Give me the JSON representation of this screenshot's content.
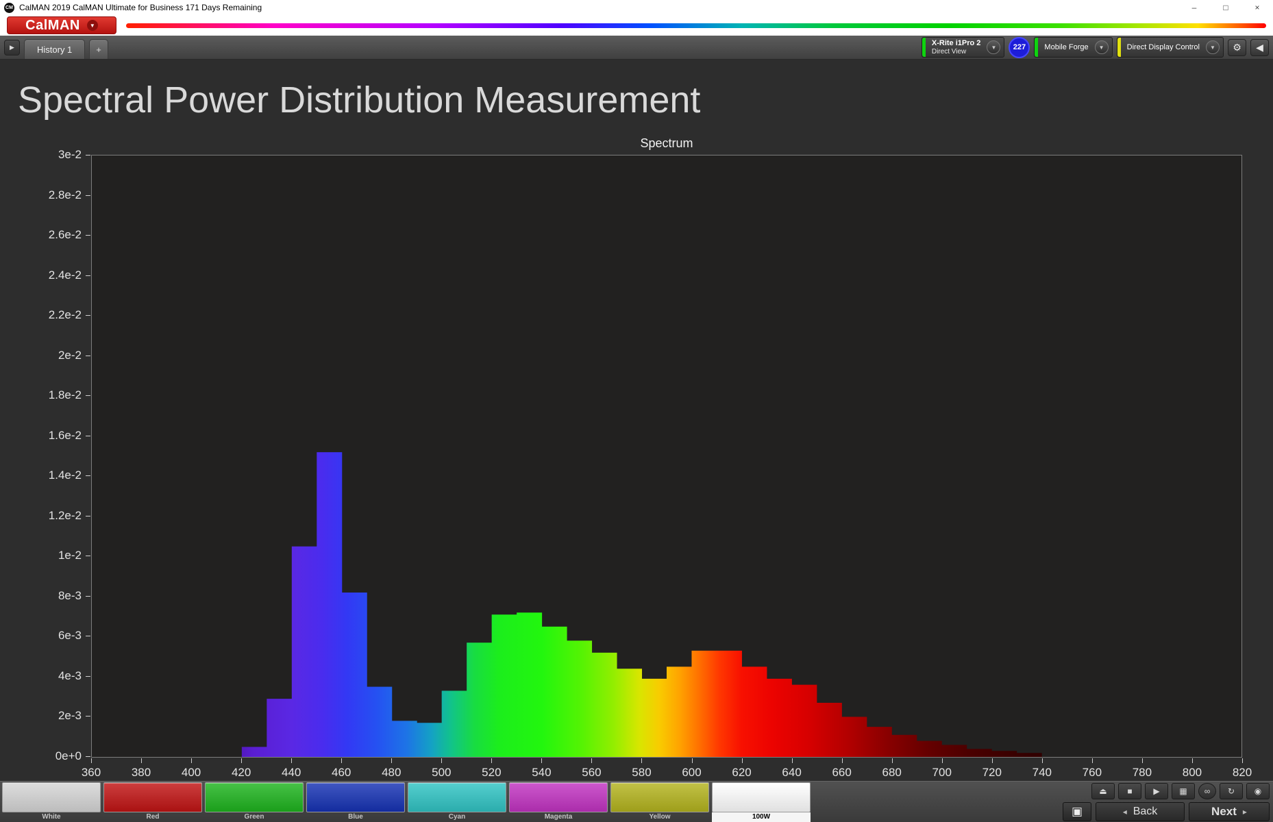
{
  "window": {
    "app_icon": "CM",
    "title": "CalMAN 2019 CalMAN Ultimate for Business 171 Days Remaining",
    "minimize_glyph": "–",
    "maximize_glyph": "□",
    "close_glyph": "×"
  },
  "brand": {
    "logo_text": "CalMAN",
    "logo_color": "#c3161c",
    "dropdown_glyph": "▼"
  },
  "tabbar": {
    "expand_glyph": "▶",
    "tabs": [
      {
        "label": "History 1"
      }
    ],
    "add_tab_label": "+",
    "meter_dropdown": {
      "line1": "X-Rite i1Pro 2",
      "line2": "Direct View",
      "accent_color": "#0fd40f",
      "arrow_glyph": "▼"
    },
    "reading_badge": {
      "value": "227",
      "color": "#1d1dd8"
    },
    "source_dropdown": {
      "label": "Mobile Forge",
      "accent_color": "#0fd40f",
      "arrow_glyph": "▼"
    },
    "display_dropdown": {
      "label": "Direct Display Control",
      "accent_color": "#e0e010",
      "arrow_glyph": "▼"
    },
    "settings_glyph": "⚙",
    "collapse_glyph": "◀"
  },
  "page": {
    "title": "Spectral Power Distribution Measurement"
  },
  "chart_data": {
    "type": "bar",
    "title": "Spectrum",
    "xlabel": "",
    "ylabel": "",
    "grid": false,
    "legend": false,
    "xlim": [
      360,
      820
    ],
    "ylim": [
      0,
      0.03
    ],
    "x_ticks": [
      360,
      380,
      400,
      420,
      440,
      460,
      480,
      500,
      520,
      540,
      560,
      580,
      600,
      620,
      640,
      660,
      680,
      700,
      720,
      740,
      760,
      780,
      800,
      820
    ],
    "y_ticks": [
      {
        "value": 0.03,
        "label": "3e-2"
      },
      {
        "value": 0.028,
        "label": "2.8e-2"
      },
      {
        "value": 0.026,
        "label": "2.6e-2"
      },
      {
        "value": 0.024,
        "label": "2.4e-2"
      },
      {
        "value": 0.022,
        "label": "2.2e-2"
      },
      {
        "value": 0.02,
        "label": "2e-2"
      },
      {
        "value": 0.018,
        "label": "1.8e-2"
      },
      {
        "value": 0.016,
        "label": "1.6e-2"
      },
      {
        "value": 0.014,
        "label": "1.4e-2"
      },
      {
        "value": 0.012,
        "label": "1.2e-2"
      },
      {
        "value": 0.01,
        "label": "1e-2"
      },
      {
        "value": 0.008,
        "label": "8e-3"
      },
      {
        "value": 0.006,
        "label": "6e-3"
      },
      {
        "value": 0.004,
        "label": "4e-3"
      },
      {
        "value": 0.002,
        "label": "2e-3"
      },
      {
        "value": 0.0,
        "label": "0e+0"
      }
    ],
    "bin_width_nm": 10,
    "bins": [
      {
        "nm": 420,
        "value": 0.0005
      },
      {
        "nm": 430,
        "value": 0.0029
      },
      {
        "nm": 440,
        "value": 0.0105
      },
      {
        "nm": 450,
        "value": 0.0152
      },
      {
        "nm": 460,
        "value": 0.0082
      },
      {
        "nm": 470,
        "value": 0.0035
      },
      {
        "nm": 480,
        "value": 0.0018
      },
      {
        "nm": 490,
        "value": 0.0017
      },
      {
        "nm": 500,
        "value": 0.0033
      },
      {
        "nm": 510,
        "value": 0.0057
      },
      {
        "nm": 520,
        "value": 0.0071
      },
      {
        "nm": 530,
        "value": 0.0072
      },
      {
        "nm": 540,
        "value": 0.0065
      },
      {
        "nm": 550,
        "value": 0.0058
      },
      {
        "nm": 560,
        "value": 0.0052
      },
      {
        "nm": 570,
        "value": 0.0044
      },
      {
        "nm": 580,
        "value": 0.0039
      },
      {
        "nm": 590,
        "value": 0.0045
      },
      {
        "nm": 600,
        "value": 0.0053
      },
      {
        "nm": 610,
        "value": 0.0053
      },
      {
        "nm": 620,
        "value": 0.0045
      },
      {
        "nm": 630,
        "value": 0.0039
      },
      {
        "nm": 640,
        "value": 0.0036
      },
      {
        "nm": 650,
        "value": 0.0027
      },
      {
        "nm": 660,
        "value": 0.002
      },
      {
        "nm": 670,
        "value": 0.0015
      },
      {
        "nm": 680,
        "value": 0.0011
      },
      {
        "nm": 690,
        "value": 0.0008
      },
      {
        "nm": 700,
        "value": 0.0006
      },
      {
        "nm": 710,
        "value": 0.0004
      },
      {
        "nm": 720,
        "value": 0.0003
      },
      {
        "nm": 730,
        "value": 0.0002
      }
    ],
    "spectrum_gradient": [
      {
        "nm": 360,
        "hex": "#240550"
      },
      {
        "nm": 405,
        "hex": "#3c0a8c"
      },
      {
        "nm": 425,
        "hex": "#5a1ed2"
      },
      {
        "nm": 440,
        "hex": "#5a28e4"
      },
      {
        "nm": 452,
        "hex": "#4a2cee"
      },
      {
        "nm": 462,
        "hex": "#3338f4"
      },
      {
        "nm": 474,
        "hex": "#2551f2"
      },
      {
        "nm": 486,
        "hex": "#1d74e6"
      },
      {
        "nm": 496,
        "hex": "#14a2c4"
      },
      {
        "nm": 504,
        "hex": "#12c488"
      },
      {
        "nm": 513,
        "hex": "#18dc42"
      },
      {
        "nm": 523,
        "hex": "#1cee1c"
      },
      {
        "nm": 540,
        "hex": "#22f60e"
      },
      {
        "nm": 556,
        "hex": "#55f303"
      },
      {
        "nm": 569,
        "hex": "#94ee00"
      },
      {
        "nm": 579,
        "hex": "#d8e600"
      },
      {
        "nm": 587,
        "hex": "#f8cc00"
      },
      {
        "nm": 595,
        "hex": "#ffa400"
      },
      {
        "nm": 603,
        "hex": "#ff7000"
      },
      {
        "nm": 611,
        "hex": "#ff3800"
      },
      {
        "nm": 620,
        "hex": "#f81000"
      },
      {
        "nm": 632,
        "hex": "#ec0300"
      },
      {
        "nm": 646,
        "hex": "#d80000"
      },
      {
        "nm": 662,
        "hex": "#b40000"
      },
      {
        "nm": 678,
        "hex": "#8a0000"
      },
      {
        "nm": 694,
        "hex": "#660000"
      },
      {
        "nm": 712,
        "hex": "#4a0000"
      },
      {
        "nm": 735,
        "hex": "#330000"
      },
      {
        "nm": 780,
        "hex": "#220000"
      }
    ]
  },
  "patch_bar": {
    "patches": [
      {
        "label": "White",
        "hex": "#d6d6d6",
        "selected": false
      },
      {
        "label": "Red",
        "hex": "#c11414",
        "selected": false
      },
      {
        "label": "Green",
        "hex": "#1eb41e",
        "selected": false
      },
      {
        "label": "Blue",
        "hex": "#1632b4",
        "selected": false
      },
      {
        "label": "Cyan",
        "hex": "#30c4c4",
        "selected": false
      },
      {
        "label": "Magenta",
        "hex": "#c233c2",
        "selected": false
      },
      {
        "label": "Yellow",
        "hex": "#b4b41e",
        "selected": false
      },
      {
        "label": "100W",
        "hex": "#ffffff",
        "selected": true
      }
    ]
  },
  "transport": {
    "top_buttons": [
      {
        "name": "eject",
        "glyph": "⏏"
      },
      {
        "name": "stop",
        "glyph": "■"
      },
      {
        "name": "play",
        "glyph": "▶"
      },
      {
        "name": "save",
        "glyph": "▦"
      },
      {
        "name": "continuous",
        "glyph": "∞"
      },
      {
        "name": "refresh",
        "glyph": "↻"
      },
      {
        "name": "record",
        "glyph": "◉"
      }
    ],
    "pattern_button_glyph": "▣",
    "back_glyph": "◂",
    "back_label": "Back",
    "next_label": "Next",
    "next_glyph": "▸"
  }
}
